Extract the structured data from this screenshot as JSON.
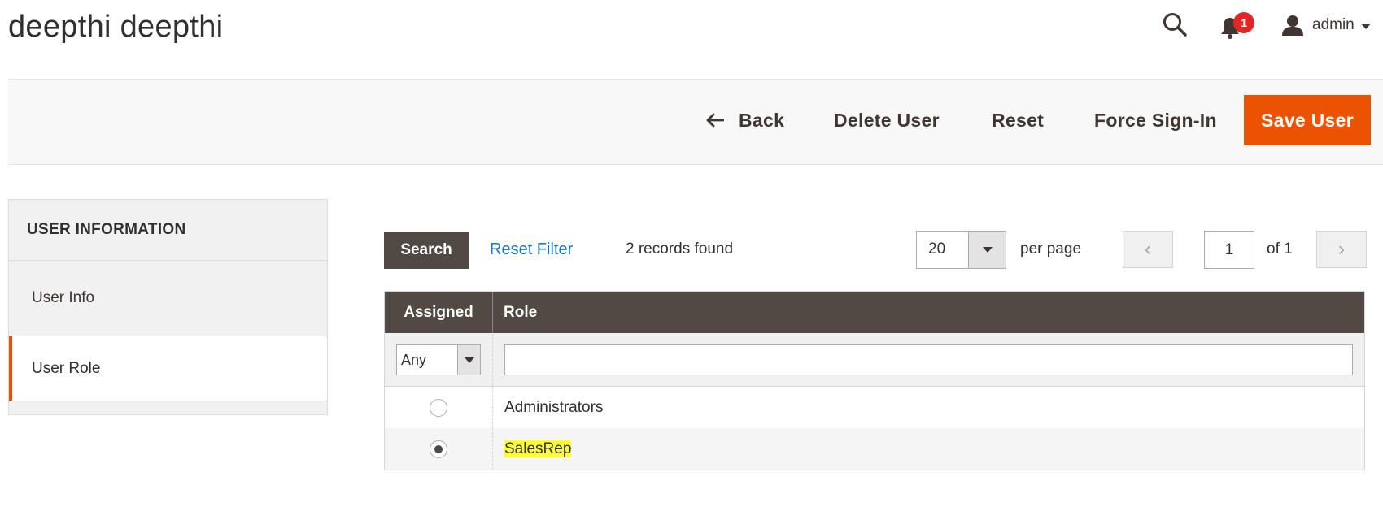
{
  "page": {
    "title": "deepthi deepthi"
  },
  "header": {
    "notifications_count": "1",
    "user_label": "admin"
  },
  "toolbar": {
    "back_label": "Back",
    "delete_label": "Delete User",
    "reset_label": "Reset",
    "force_signin_label": "Force Sign-In",
    "save_label": "Save User"
  },
  "sidebar": {
    "title": "USER INFORMATION",
    "items": [
      {
        "label": "User Info",
        "active": false
      },
      {
        "label": "User Role",
        "active": true
      }
    ]
  },
  "grid_controls": {
    "search_label": "Search",
    "reset_filter_label": "Reset Filter",
    "records_found": "2 records found",
    "per_page_value": "20",
    "per_page_label": "per page",
    "page_value": "1",
    "page_of": "of 1"
  },
  "grid": {
    "columns": [
      "Assigned",
      "Role"
    ],
    "filter_assigned_value": "Any",
    "filter_role_value": "",
    "rows": [
      {
        "assigned": false,
        "role": "Administrators"
      },
      {
        "assigned": true,
        "role": "SalesRep"
      }
    ]
  },
  "colors": {
    "accent": "#eb5202",
    "header_bg": "#514943",
    "link": "#1979c3",
    "badge": "#e22626",
    "highlight": "#ffff33"
  }
}
